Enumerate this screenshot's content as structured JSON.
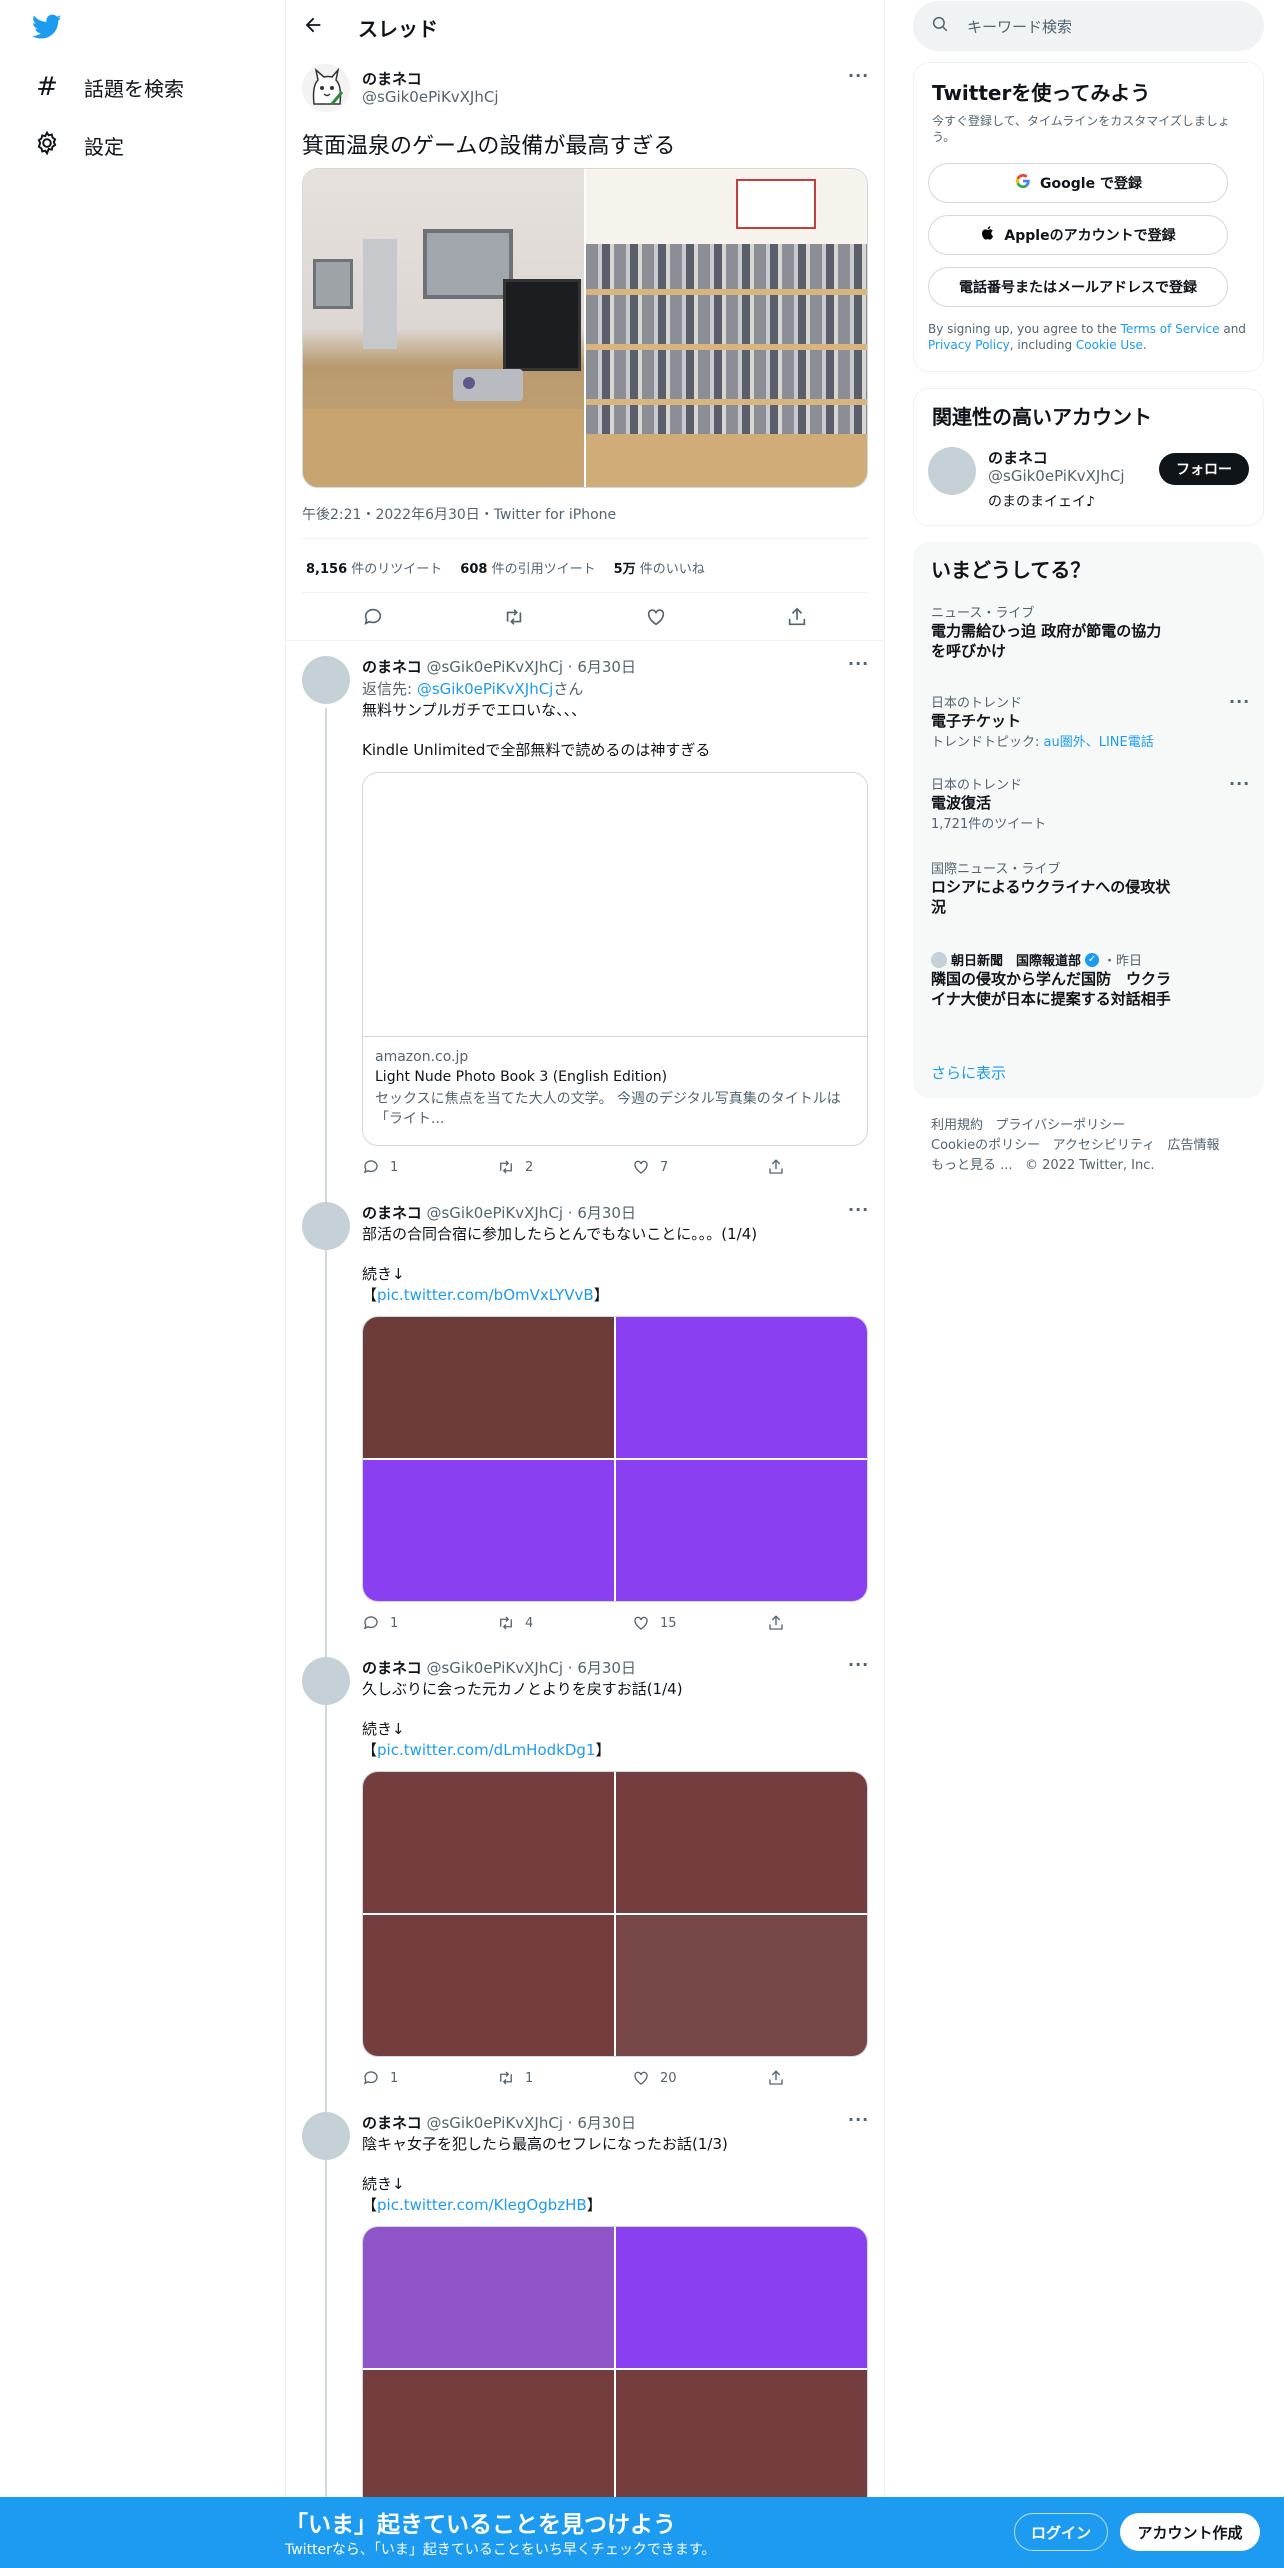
{
  "nav": {
    "explore_label": "話題を検索",
    "settings_label": "設定"
  },
  "header": {
    "title": "スレッド"
  },
  "main_tweet": {
    "name": "のまネコ",
    "handle": "@sGik0ePiKvXJhCj",
    "text": "箕面温泉のゲームの設備が最高すぎる",
    "meta": "午後2:21・2022年6月30日・Twitter for iPhone",
    "retweets_count": "8,156",
    "retweets_label": "件のリツイート",
    "quotes_count": "608",
    "quotes_label": "件の引用ツイート",
    "likes_count": "5万",
    "likes_label": "件のいいね"
  },
  "replies": [
    {
      "name": "のまネコ",
      "handle": "@sGik0ePiKvXJhCj",
      "date": "6月30日",
      "reply_prefix": "返信先: ",
      "reply_to": "@sGik0ePiKvXJhCj",
      "reply_suffix": "さん",
      "text": "無料サンプルガチでエロいな、、、\n\nKindle Unlimitedで全部無料で読めるのは神すぎる",
      "card": {
        "domain": "amazon.co.jp",
        "title": "Light Nude Photo Book 3 (English Edition)",
        "desc": "セックスに焦点を当てた大人の文学。 今週のデジタル写真集のタイトルは「ライト..."
      },
      "replies_count": "1",
      "retweets_count": "2",
      "likes_count": "7"
    },
    {
      "name": "のまネコ",
      "handle": "@sGik0ePiKvXJhCj",
      "date": "6月30日",
      "text": "部活の合同合宿に参加したらとんでもないことに。。。(1/4)\n\n続き↓",
      "link_open": "【",
      "link": "pic.twitter.com/bOmVxLYVvB",
      "link_close": "】",
      "photos": [
        "#6e3b3b",
        "#8a3ff0",
        "#8a3ff0",
        "#8a3ff0"
      ],
      "replies_count": "1",
      "retweets_count": "4",
      "likes_count": "15"
    },
    {
      "name": "のまネコ",
      "handle": "@sGik0ePiKvXJhCj",
      "date": "6月30日",
      "text": "久しぶりに会った元カノとよりを戻すお話(1/4)\n\n続き↓",
      "link_open": "【",
      "link": "pic.twitter.com/dLmHodkDg1",
      "link_close": "】",
      "photos": [
        "#753e3e",
        "#753e3e",
        "#753e3e",
        "#774646"
      ],
      "replies_count": "1",
      "retweets_count": "1",
      "likes_count": "20"
    },
    {
      "name": "のまネコ",
      "handle": "@sGik0ePiKvXJhCj",
      "date": "6月30日",
      "text": "陰キャ女子を犯したら最高のセフレになったお話(1/3)\n\n続き↓",
      "link_open": "【",
      "link": "pic.twitter.com/KlegOgbzHB",
      "link_close": "】",
      "photos": [
        "#8f54c8",
        "#8a3ff0",
        "#753e3e",
        "#753e3e"
      ]
    }
  ],
  "search": {
    "placeholder": "キーワード検索"
  },
  "signup": {
    "title": "Twitterを使ってみよう",
    "subtitle": "今すぐ登録して、タイムラインをカスタマイズしましょう。",
    "google_label": "Google で登録",
    "apple_label": "Appleのアカウントで登録",
    "phone_label": "電話番号またはメールアドレスで登録",
    "terms_prefix": "By signing up, you agree to the ",
    "terms_link": "Terms of Service",
    "terms_and": " and ",
    "privacy_link": "Privacy Policy",
    "terms_including": ", including ",
    "cookie_link": "Cookie Use",
    "terms_end": "."
  },
  "relevant": {
    "title": "関連性の高いアカウント",
    "name": "のまネコ",
    "handle": "@sGik0ePiKvXJhCj",
    "bio": "のまのまイェイ♪",
    "follow_label": "フォロー"
  },
  "trends": {
    "title": "いまどうしてる？",
    "items": [
      {
        "context": "ニュース・ライブ",
        "title": "電力需給ひっ迫 政府が節電の協力を呼びかけ"
      },
      {
        "context": "日本のトレンド",
        "title": "電子チケット",
        "sub_prefix": "トレンドトピック: ",
        "sub_link": "au圏外、LINE電話"
      },
      {
        "context": "日本のトレンド",
        "title": "電波復活",
        "sub": "1,721件のツイート"
      },
      {
        "context": "国際ニュース・ライブ",
        "title": "ロシアによるウクライナへの侵攻状況"
      },
      {
        "source": "朝日新聞　国際報道部",
        "time": "・昨日",
        "title": "隣国の侵攻から学んだ国防　ウクライナ大使が日本に提案する対話相手"
      }
    ],
    "show_more": "さらに表示"
  },
  "footer": {
    "links": [
      "利用規約",
      "プライバシーポリシー",
      "Cookieのポリシー",
      "アクセシビリティ",
      "広告情報",
      "もっと見る ..."
    ],
    "copyright": "© 2022 Twitter, Inc."
  },
  "bottom_bar": {
    "title": "「いま」起きていることを見つけよう",
    "subtitle": "Twitterなら、「いま」起きていることをいち早くチェックできます。",
    "login_label": "ログイン",
    "signup_label": "アカウント作成"
  },
  "colors": {
    "brand": "#1d9bf0",
    "text": "#0f1419",
    "muted": "#536471"
  }
}
